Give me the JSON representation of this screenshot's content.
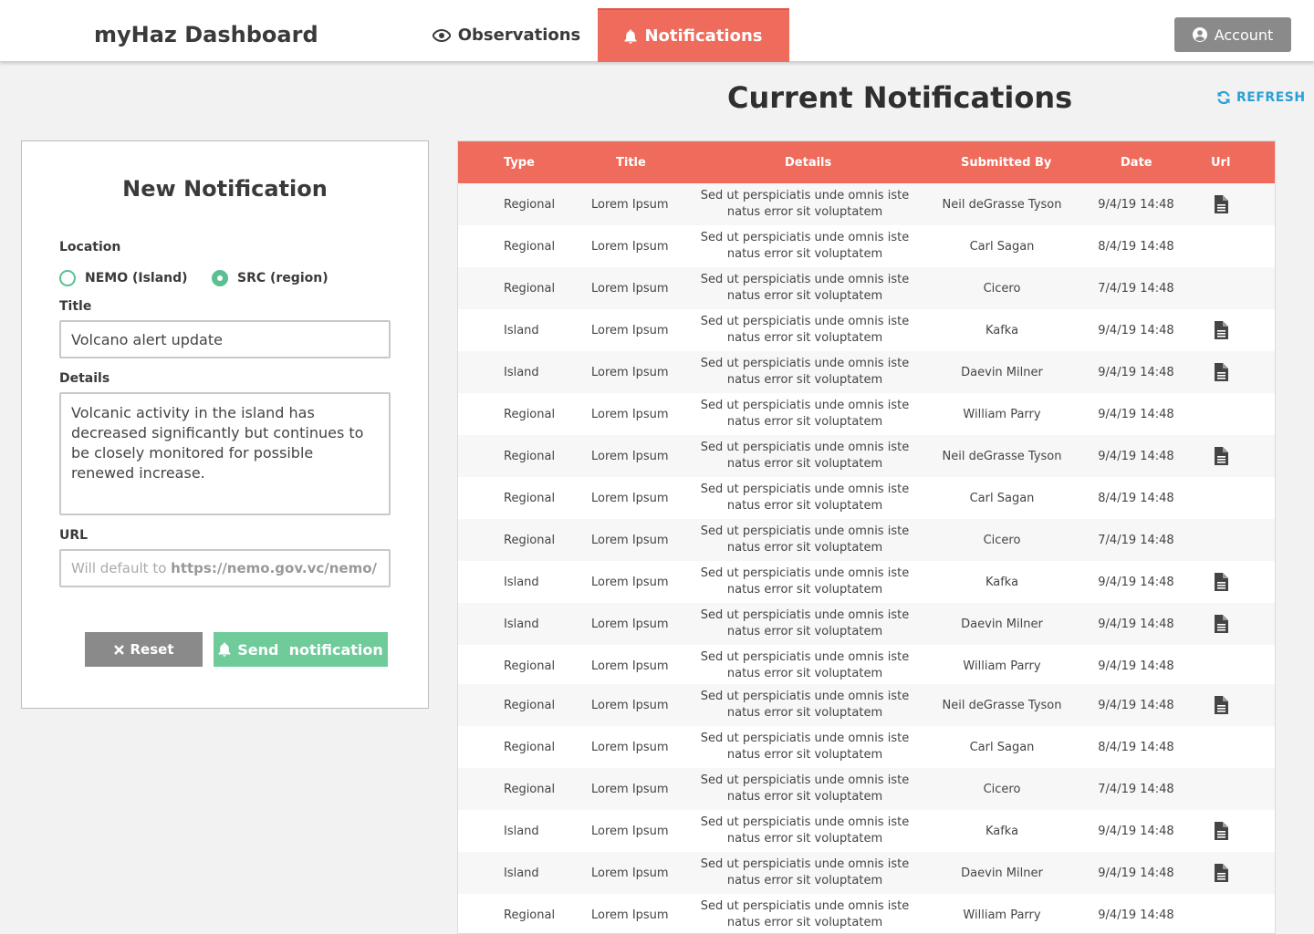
{
  "header": {
    "brand": "myHaz Dashboard",
    "tabs": [
      {
        "label": "Observations",
        "icon": "eye-icon",
        "active": false
      },
      {
        "label": "Notifications",
        "icon": "bell-icon",
        "active": true
      }
    ],
    "account_label": "Account"
  },
  "main": {
    "title": "Current Notifications",
    "refresh_label": "REFRESH"
  },
  "form": {
    "title": "New Notification",
    "location_label": "Location",
    "options": [
      {
        "label": "NEMO (Island)",
        "selected": false
      },
      {
        "label": "SRC (region)",
        "selected": true
      }
    ],
    "title_label": "Title",
    "title_value": "Volcano alert update",
    "details_label": "Details",
    "details_value": "Volcanic activity in the island has decreased significantly but continues to be closely monitored for possible renewed increase.",
    "url_label": "URL",
    "url_placeholder_prefix": "Will default to ",
    "url_placeholder_url": "https://nemo.gov.vc/nemo/",
    "reset_label": "Reset",
    "send_label": "Send  notification"
  },
  "colors": {
    "accent": "#ef6b5b",
    "green": "#6fcb9a",
    "link": "#2a9fd6",
    "gray_button": "#8a8a8a"
  },
  "table": {
    "headers": [
      "Type",
      "Title",
      "Details",
      "Submitted By",
      "Date",
      "Url"
    ],
    "rows": [
      {
        "type": "Regional",
        "title": "Lorem Ipsum",
        "details": "Sed ut perspiciatis unde omnis iste natus error sit voluptatem",
        "by": "Neil deGrasse Tyson",
        "date": "9/4/19 14:48",
        "url": true
      },
      {
        "type": "Regional",
        "title": "Lorem Ipsum",
        "details": "Sed ut perspiciatis unde omnis iste natus error sit voluptatem",
        "by": "Carl Sagan",
        "date": "8/4/19 14:48",
        "url": false
      },
      {
        "type": "Regional",
        "title": "Lorem Ipsum",
        "details": "Sed ut perspiciatis unde omnis iste natus error sit voluptatem",
        "by": "Cicero",
        "date": "7/4/19 14:48",
        "url": false
      },
      {
        "type": "Island",
        "title": "Lorem Ipsum",
        "details": "Sed ut perspiciatis unde omnis iste natus error sit voluptatem",
        "by": "Kafka",
        "date": "9/4/19 14:48",
        "url": true
      },
      {
        "type": "Island",
        "title": "Lorem Ipsum",
        "details": "Sed ut perspiciatis unde omnis iste natus error sit voluptatem",
        "by": "Daevin Milner",
        "date": "9/4/19 14:48",
        "url": true
      },
      {
        "type": "Regional",
        "title": "Lorem Ipsum",
        "details": "Sed ut perspiciatis unde omnis iste natus error sit voluptatem",
        "by": "William Parry",
        "date": "9/4/19 14:48",
        "url": false
      },
      {
        "type": "Regional",
        "title": "Lorem Ipsum",
        "details": "Sed ut perspiciatis unde omnis iste natus error sit voluptatem",
        "by": "Neil deGrasse Tyson",
        "date": "9/4/19 14:48",
        "url": true
      },
      {
        "type": "Regional",
        "title": "Lorem Ipsum",
        "details": "Sed ut perspiciatis unde omnis iste natus error sit voluptatem",
        "by": "Carl Sagan",
        "date": "8/4/19 14:48",
        "url": false
      },
      {
        "type": "Regional",
        "title": "Lorem Ipsum",
        "details": "Sed ut perspiciatis unde omnis iste natus error sit voluptatem",
        "by": "Cicero",
        "date": "7/4/19 14:48",
        "url": false
      },
      {
        "type": "Island",
        "title": "Lorem Ipsum",
        "details": "Sed ut perspiciatis unde omnis iste natus error sit voluptatem",
        "by": "Kafka",
        "date": "9/4/19 14:48",
        "url": true
      },
      {
        "type": "Island",
        "title": "Lorem Ipsum",
        "details": "Sed ut perspiciatis unde omnis iste natus error sit voluptatem",
        "by": "Daevin Milner",
        "date": "9/4/19 14:48",
        "url": true
      },
      {
        "type": "Regional",
        "title": "Lorem Ipsum",
        "details": "Sed ut perspiciatis unde omnis iste natus error sit voluptatem",
        "by": "William Parry",
        "date": "9/4/19 14:48",
        "url": false
      },
      {
        "type": "Regional",
        "title": "Lorem Ipsum",
        "details": "Sed ut perspiciatis unde omnis iste natus error sit voluptatem",
        "by": "Neil deGrasse Tyson",
        "date": "9/4/19 14:48",
        "url": true
      },
      {
        "type": "Regional",
        "title": "Lorem Ipsum",
        "details": "Sed ut perspiciatis unde omnis iste natus error sit voluptatem",
        "by": "Carl Sagan",
        "date": "8/4/19 14:48",
        "url": false
      },
      {
        "type": "Regional",
        "title": "Lorem Ipsum",
        "details": "Sed ut perspiciatis unde omnis iste natus error sit voluptatem",
        "by": "Cicero",
        "date": "7/4/19 14:48",
        "url": false
      },
      {
        "type": "Island",
        "title": "Lorem Ipsum",
        "details": "Sed ut perspiciatis unde omnis iste natus error sit voluptatem",
        "by": "Kafka",
        "date": "9/4/19 14:48",
        "url": true
      },
      {
        "type": "Island",
        "title": "Lorem Ipsum",
        "details": "Sed ut perspiciatis unde omnis iste natus error sit voluptatem",
        "by": "Daevin Milner",
        "date": "9/4/19 14:48",
        "url": true
      },
      {
        "type": "Regional",
        "title": "Lorem Ipsum",
        "details": "Sed ut perspiciatis unde omnis iste natus error sit voluptatem",
        "by": "William Parry",
        "date": "9/4/19 14:48",
        "url": false
      }
    ]
  }
}
